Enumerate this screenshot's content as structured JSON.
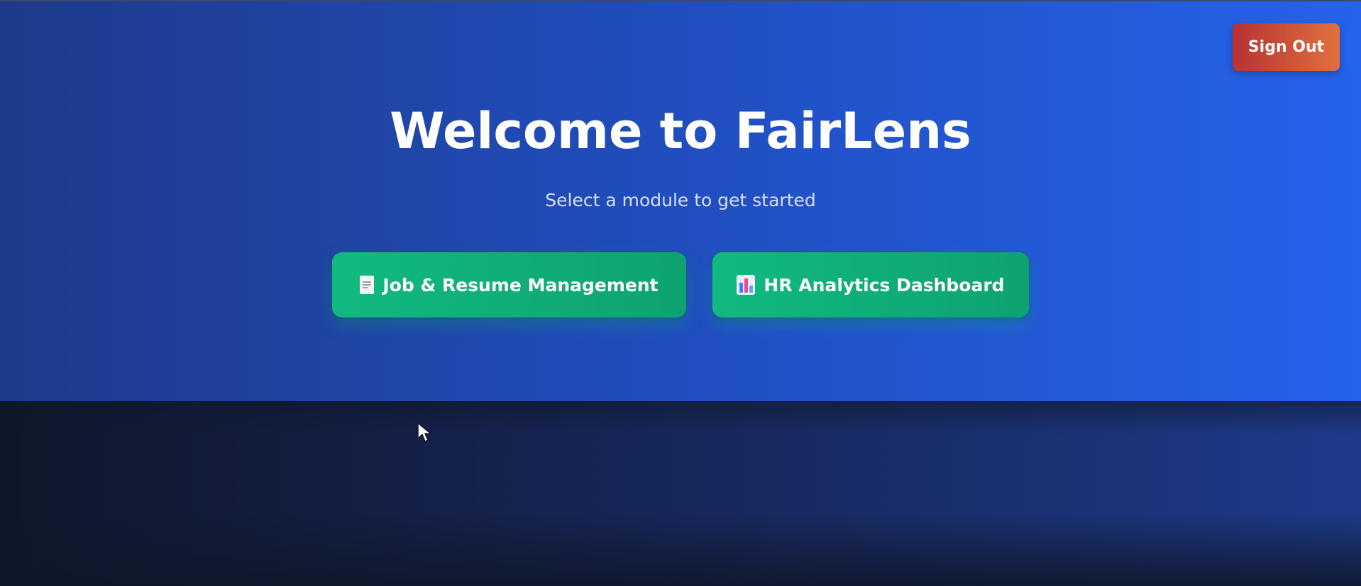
{
  "header": {
    "signout_label": "Sign Out"
  },
  "main": {
    "title": "Welcome to FairLens",
    "subtitle": "Select a module to get started",
    "modules": [
      {
        "label": "Job & Resume Management",
        "icon": "document-icon"
      },
      {
        "label": "HR Analytics Dashboard",
        "icon": "bar-chart-icon"
      }
    ]
  },
  "colors": {
    "hero_gradient_start": "#1e3a8a",
    "hero_gradient_end": "#2563eb",
    "module_button": "#10b981",
    "signout_gradient_start": "#b83232",
    "signout_gradient_end": "#e0703f"
  }
}
